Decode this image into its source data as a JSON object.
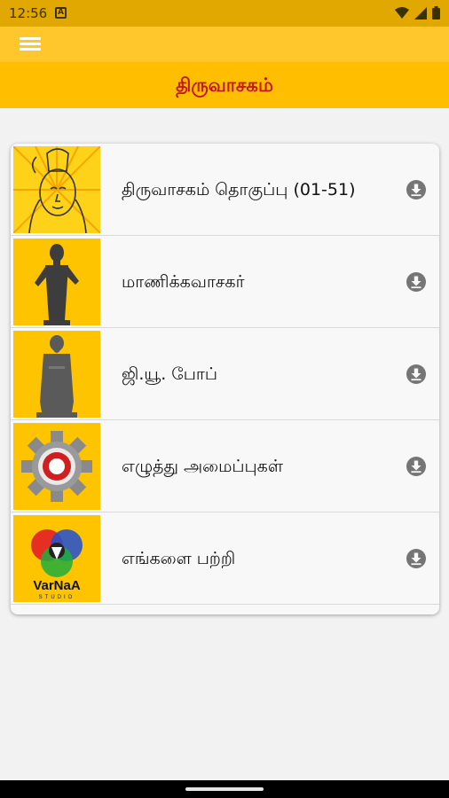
{
  "status_bar": {
    "time": "12:56",
    "notification_letter": "A"
  },
  "app_bar": {
    "menu_icon": "hamburger-menu-icon",
    "bg_color": "#ffc72c"
  },
  "header": {
    "title": "திருவாசகம்",
    "title_color": "#c0141a",
    "bg_color": "#ffbf00"
  },
  "menu_items": [
    {
      "label": "திருவாசகம் தொகுப்பு (01-51)",
      "thumb": "shiva-image",
      "action_icon": "download-icon"
    },
    {
      "label": "மாணிக்கவாசகர்",
      "thumb": "manikkavasagar-statue-image",
      "action_icon": "download-icon"
    },
    {
      "label": "ஜி.யூ. போப்",
      "thumb": "gu-pope-statue-image",
      "action_icon": "download-icon"
    },
    {
      "label": "எழுத்து அமைப்புகள்",
      "thumb": "settings-gear-image",
      "action_icon": "download-icon"
    },
    {
      "label": "எங்களை பற்றி",
      "thumb": "varnaa-logo",
      "action_icon": "download-icon"
    }
  ],
  "about_logo": {
    "brand": "VarNaA",
    "subtitle": "STUDIO"
  }
}
